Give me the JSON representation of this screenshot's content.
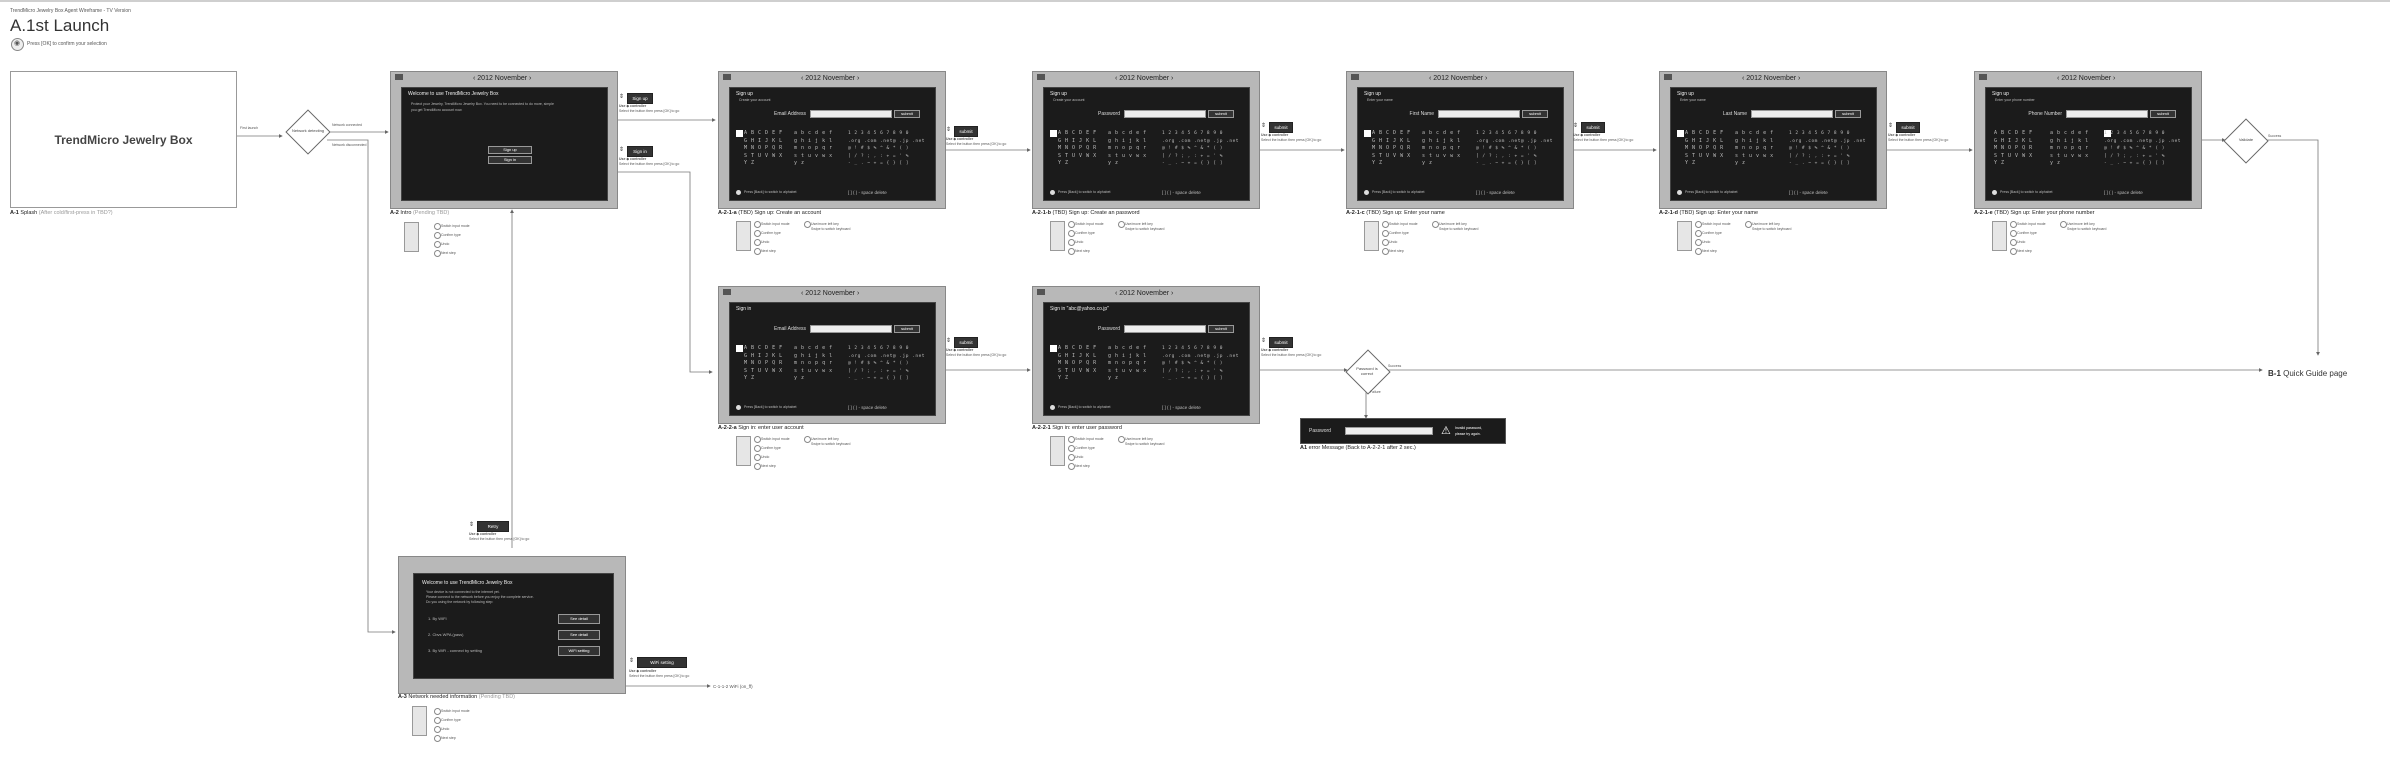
{
  "header": {
    "small": "TrendMicro Jewelry Box Agent Wireframe - TV Version",
    "title": "A.1st Launch",
    "press_hint": "Press [OK] to confirm your selection"
  },
  "splash": {
    "title": "TrendMicro Jewelry Box",
    "label_id": "A-1",
    "label_text": "Splash",
    "label_note": "(After cold/first-press in TBD?)",
    "arrow_note": "First launch"
  },
  "diamonds": {
    "network": "Network detecting",
    "network_yes": "Network connected",
    "network_no": "Network disconnected",
    "login_check": "Validate",
    "login_check_out": "Success",
    "password_check": "Password is correct",
    "password_yes": "Success",
    "password_no": "Failure"
  },
  "date": "2012 November",
  "screens": {
    "intro": {
      "title": "Welcome to use TrendMicro Jewelry Box",
      "body1": "Protect your Jewelry, TrendMicro Jewelry Box. You need to be connected to do more, simple",
      "body2": "you get TrendMicro account now.",
      "btn1": "Sign up",
      "btn2": "Sign in",
      "label_id": "A-2",
      "label_text": "Intro",
      "label_note": "(Pending TBD)"
    },
    "email": {
      "title": "Sign up",
      "sub": "Create your account",
      "field": "Email Address",
      "label_id": "A-2-1-a",
      "label_text": "(TBD) Sign up: Create an account"
    },
    "password": {
      "title": "Sign up",
      "sub": "Create your account",
      "field": "Password",
      "label_id": "A-2-1-b",
      "label_text": "(TBD) Sign up: Create an password"
    },
    "firstname": {
      "title": "Sign up",
      "sub": "Enter your name",
      "field": "First Name",
      "label_id": "A-2-1-c",
      "label_text": "(TBD) Sign up: Enter your name"
    },
    "lastname": {
      "title": "Sign up",
      "sub": "Enter your name",
      "field": "Last Name",
      "label_id": "A-2-1-d",
      "label_text": "(TBD) Sign up: Enter your name"
    },
    "phone": {
      "title": "Sign up",
      "sub": "Enter your phone number",
      "field": "Phone Number",
      "label_id": "A-2-1-e",
      "label_text": "(TBD) Sign up: Enter your phone number"
    },
    "signin": {
      "title": "Sign in",
      "field": "Email Address",
      "label_id": "A-2-2-a",
      "label_text": "Sign in: enter user account"
    },
    "signin_pw": {
      "title": "Sign in \"abc@yahoo.co.jp\"",
      "field": "Password",
      "label_id": "A-2-2-1",
      "label_text": "Sign in: enter user password"
    },
    "network": {
      "title": "Welcome to use TrendMicro Jewelry Box",
      "body1": "Your device is not connected to the internet yet.",
      "body2": "Please connect to the network before you enjoy the complete service.",
      "body3": "Do you using the network by following step:",
      "row1": "1. By WIFI",
      "row2": "2. Cbvs WPA (pass)",
      "row3": "3. By WiFi - connect by setting",
      "btn1": "See detail",
      "btn2": "See detail",
      "btn3": "WiFi setting",
      "label_id": "A-3",
      "label_text": "Network needed information",
      "label_note": "(Pending TBD)"
    }
  },
  "submit": "submit",
  "keyboard": {
    "caps": "A B C D E F\nG H I J K L\nM N O P Q R\nS T U V W X\nY Z",
    "lower": "a b c d e f\ng h i j k l\nm n o p q r\ns t u v w x\ny z",
    "nums": "1 2 3 4 5 6 7 8 9 0\n.org .com .net@ .jp .net\n@ ! # $ % ^ & * ( )\n[ / ? ; , : + = ' %\n- _ . ~ + = { } [ ]",
    "foot": "[ ] ( ) -  space  delete",
    "shortcut": "Press [Back] to switch to alphabet"
  },
  "remote": {
    "a": "Switch input mode",
    "b": "Confirm type",
    "c": "Undo",
    "d": "Next step",
    "e": "Use/move left key",
    "f": "Swipe to switch keyboard"
  },
  "actions": {
    "sign_up": "Sign up",
    "sign_in": "Sign in",
    "submit": "submit",
    "retry": "Retry",
    "wifi": "WiFi setting",
    "use_ctrl": "Use ◆ controller",
    "nav_note": "Select the button then press [OK] to go"
  },
  "error": {
    "field": "Password",
    "msg1": "Invalid password,",
    "msg2": "please try again.",
    "label_id": "A1",
    "label_text": "error Message (Back to A-2-2-1 after 2 sec.)"
  },
  "exits": {
    "b1_id": "B-1",
    "b1_text": "Quick Guide page",
    "c_text": "C-1-1-2 WiFi (on_ff)"
  }
}
